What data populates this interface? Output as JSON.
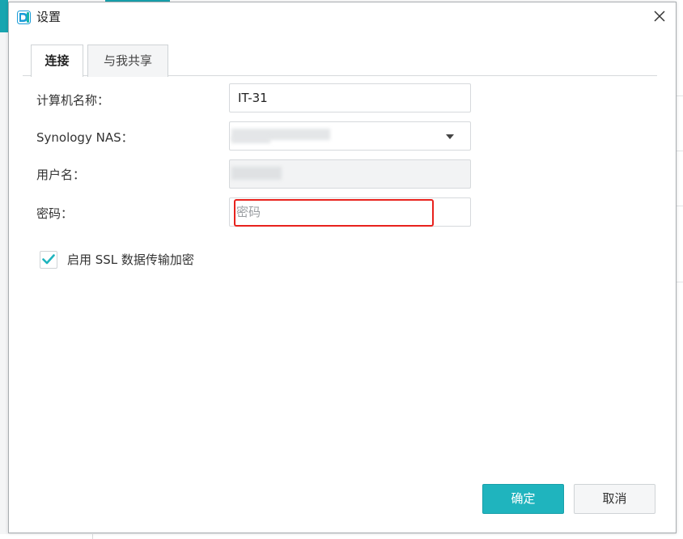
{
  "window": {
    "title": "设置",
    "app_icon": "synology-drive-icon",
    "close_icon": "close-icon"
  },
  "tabs": [
    {
      "label": "连接",
      "active": true
    },
    {
      "label": "与我共享",
      "active": false
    }
  ],
  "form": {
    "computer_name": {
      "label": "计算机名称：",
      "value": "IT-31"
    },
    "nas": {
      "label": "Synology NAS：",
      "value": ""
    },
    "username": {
      "label": "用户名：",
      "value": ""
    },
    "password": {
      "label": "密码：",
      "placeholder": "密码",
      "value": ""
    },
    "ssl": {
      "label": "启用 SSL 数据传输加密",
      "checked": true
    }
  },
  "buttons": {
    "ok": "确定",
    "cancel": "取消"
  },
  "colors": {
    "accent": "#1fb4be",
    "highlight": "#e8221d"
  }
}
